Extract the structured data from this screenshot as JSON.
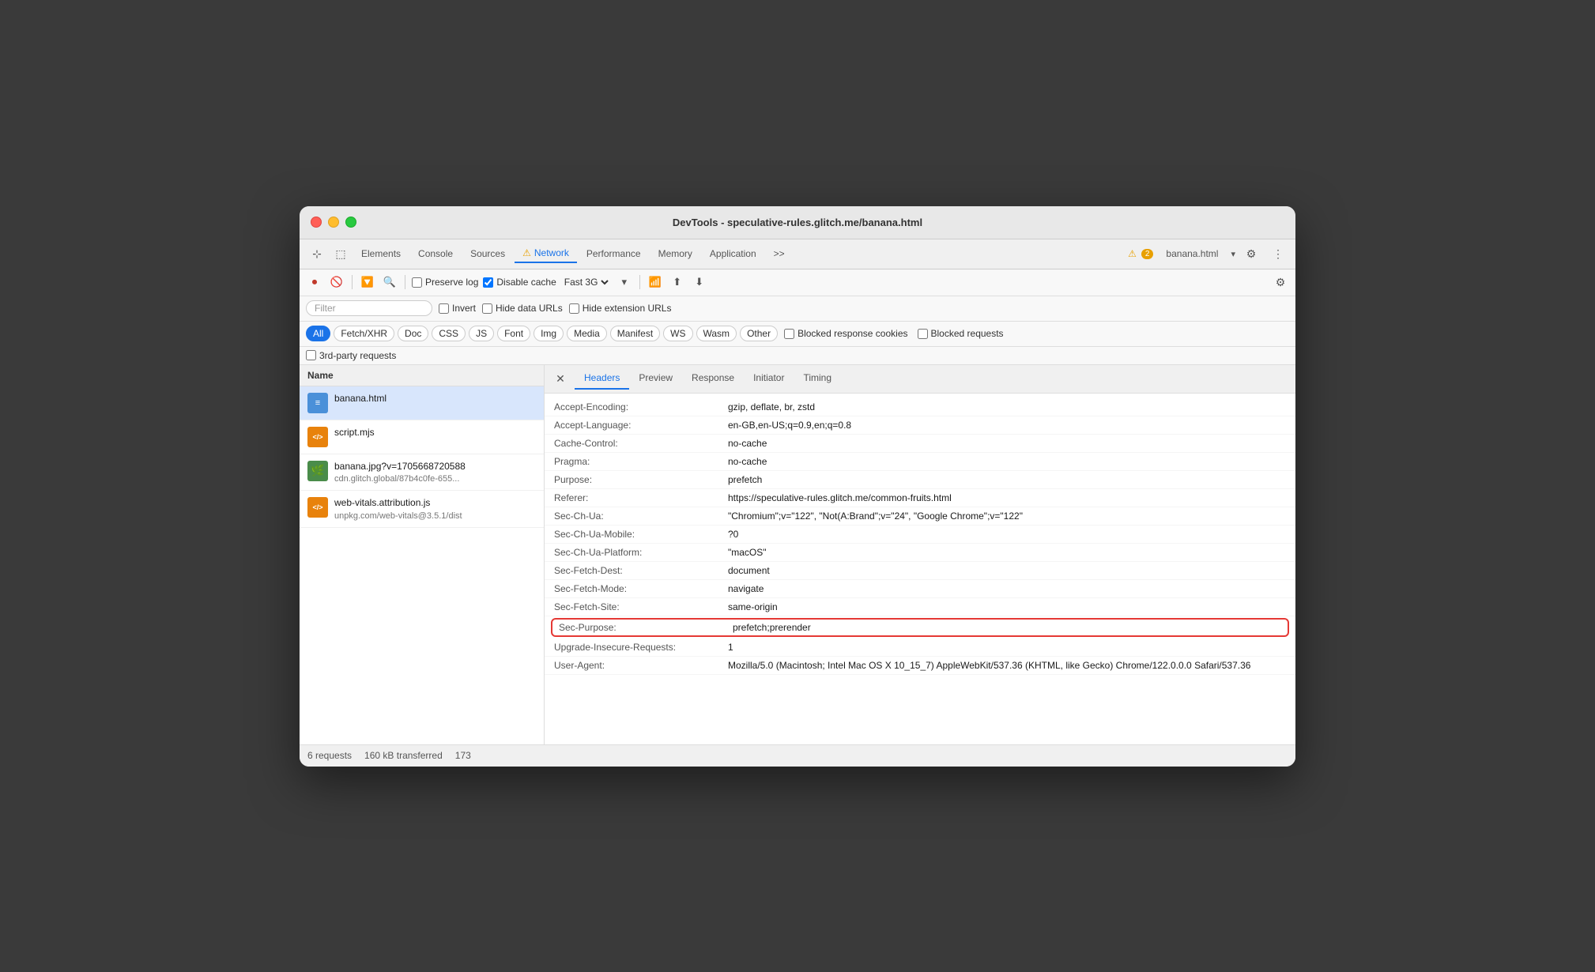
{
  "window": {
    "title": "DevTools - speculative-rules.glitch.me/banana.html"
  },
  "devtools_tabs": {
    "items": [
      "Elements",
      "Console",
      "Sources",
      "Network",
      "Performance",
      "Memory",
      "Application"
    ],
    "active": "Network",
    "more": ">>",
    "warning_count": "2",
    "page_label": "banana.html"
  },
  "toolbar": {
    "preserve_log": "Preserve log",
    "disable_cache": "Disable cache",
    "network_throttle": "Fast 3G"
  },
  "filter_bar": {
    "placeholder": "Filter",
    "invert": "Invert",
    "hide_data_urls": "Hide data URLs",
    "hide_extension_urls": "Hide extension URLs"
  },
  "type_buttons": [
    "All",
    "Fetch/XHR",
    "Doc",
    "CSS",
    "JS",
    "Font",
    "Img",
    "Media",
    "Manifest",
    "WS",
    "Wasm",
    "Other"
  ],
  "active_type": "All",
  "blocked_cookies": "Blocked response cookies",
  "blocked_requests": "Blocked requests",
  "third_party": "3rd-party requests",
  "file_list": {
    "header": "Name",
    "items": [
      {
        "name": "banana.html",
        "icon_type": "html",
        "icon_label": "≡",
        "selected": true
      },
      {
        "name": "script.mjs",
        "icon_type": "js",
        "icon_label": "</>",
        "selected": false
      },
      {
        "name": "banana.jpg?v=1705668720588",
        "sub": "cdn.glitch.global/87b4c0fe-655...",
        "icon_type": "img",
        "icon_label": "🌿",
        "selected": false
      },
      {
        "name": "web-vitals.attribution.js",
        "sub": "unpkg.com/web-vitals@3.5.1/dist",
        "icon_type": "js",
        "icon_label": "</>",
        "selected": false
      }
    ]
  },
  "detail_tabs": [
    "Headers",
    "Preview",
    "Response",
    "Initiator",
    "Timing"
  ],
  "active_detail_tab": "Headers",
  "headers": [
    {
      "name": "Accept-Encoding:",
      "value": "gzip, deflate, br, zstd",
      "highlighted": false
    },
    {
      "name": "Accept-Language:",
      "value": "en-GB,en-US;q=0.9,en;q=0.8",
      "highlighted": false
    },
    {
      "name": "Cache-Control:",
      "value": "no-cache",
      "highlighted": false
    },
    {
      "name": "Pragma:",
      "value": "no-cache",
      "highlighted": false
    },
    {
      "name": "Purpose:",
      "value": "prefetch",
      "highlighted": false
    },
    {
      "name": "Referer:",
      "value": "https://speculative-rules.glitch.me/common-fruits.html",
      "highlighted": false
    },
    {
      "name": "Sec-Ch-Ua:",
      "value": "\"Chromium\";v=\"122\", \"Not(A:Brand\";v=\"24\", \"Google Chrome\";v=\"122\"",
      "highlighted": false
    },
    {
      "name": "Sec-Ch-Ua-Mobile:",
      "value": "?0",
      "highlighted": false
    },
    {
      "name": "Sec-Ch-Ua-Platform:",
      "value": "\"macOS\"",
      "highlighted": false
    },
    {
      "name": "Sec-Fetch-Dest:",
      "value": "document",
      "highlighted": false
    },
    {
      "name": "Sec-Fetch-Mode:",
      "value": "navigate",
      "highlighted": false
    },
    {
      "name": "Sec-Fetch-Site:",
      "value": "same-origin",
      "highlighted": false
    },
    {
      "name": "Sec-Purpose:",
      "value": "prefetch;prerender",
      "highlighted": true
    },
    {
      "name": "Upgrade-Insecure-Requests:",
      "value": "1",
      "highlighted": false
    },
    {
      "name": "User-Agent:",
      "value": "Mozilla/5.0 (Macintosh; Intel Mac OS X 10_15_7) AppleWebKit/537.36 (KHTML, like Gecko) Chrome/122.0.0.0 Safari/537.36",
      "highlighted": false
    }
  ],
  "status_bar": {
    "requests": "6 requests",
    "transferred": "160 kB transferred",
    "extra": "173"
  }
}
